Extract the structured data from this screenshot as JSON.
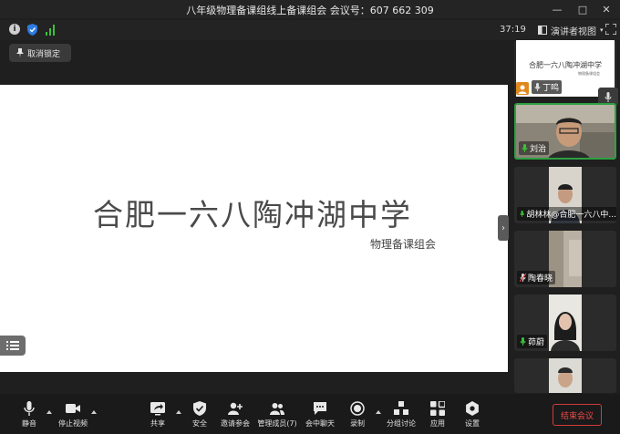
{
  "window": {
    "title": "八年级物理备课组线上备课组会 会议号：607 662 309",
    "controls": [
      "minimize-icon",
      "maximize-icon",
      "close-icon"
    ]
  },
  "infobar": {
    "timer": "37:19",
    "view_label": "演讲者视图",
    "icons": [
      "info-icon",
      "shield-icon",
      "signal-icon",
      "fullscreen-icon"
    ]
  },
  "unlock_button": {
    "label": "取消锁定"
  },
  "slide": {
    "title": "合肥一六八陶冲湖中学",
    "subtitle": "物理备课组会"
  },
  "participants": [
    {
      "name": "丁鸣",
      "type": "screen-share",
      "thumb_title": "合肥一六八陶冲湖中学",
      "thumb_sub": "物理备课组会"
    },
    {
      "name": "刘治",
      "type": "video",
      "active": true
    },
    {
      "name": "胡林林@合肥一六八中...",
      "type": "video"
    },
    {
      "name": "陶春晓",
      "type": "video"
    },
    {
      "name": "茆蔚",
      "type": "video"
    },
    {
      "name": "",
      "type": "video"
    }
  ],
  "toolbar": {
    "mute": "静音",
    "stop_video": "停止视频",
    "share": "共享",
    "security": "安全",
    "invite": "邀请参会",
    "participants": "管理成员(7)",
    "chat": "会中聊天",
    "record": "录制",
    "breakout": "分组讨论",
    "apps": "应用",
    "settings": "设置",
    "end": "结束会议"
  },
  "colors": {
    "accent_green": "#2ea043",
    "end_red": "#ef4a4a",
    "shield_blue": "#2d7be0",
    "signal_green": "#3cc13b",
    "host_orange": "#e08a1e"
  }
}
